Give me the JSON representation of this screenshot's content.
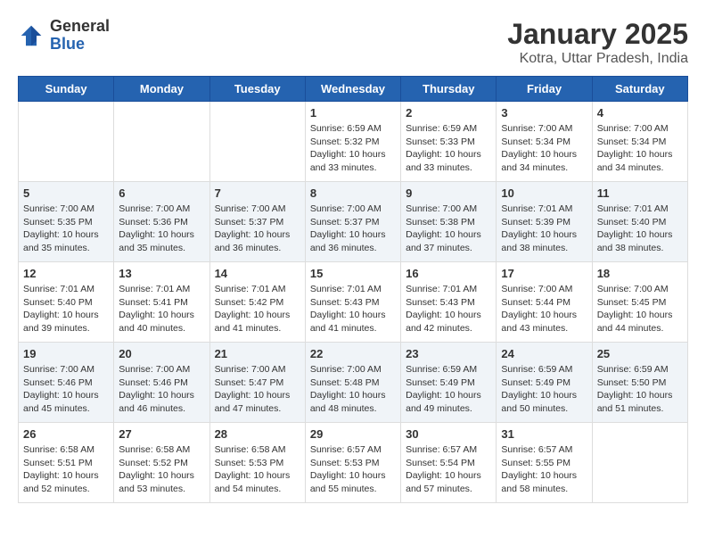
{
  "header": {
    "logo_general": "General",
    "logo_blue": "Blue",
    "title": "January 2025",
    "subtitle": "Kotra, Uttar Pradesh, India"
  },
  "days_of_week": [
    "Sunday",
    "Monday",
    "Tuesday",
    "Wednesday",
    "Thursday",
    "Friday",
    "Saturday"
  ],
  "weeks": [
    [
      {
        "day": "",
        "info": ""
      },
      {
        "day": "",
        "info": ""
      },
      {
        "day": "",
        "info": ""
      },
      {
        "day": "1",
        "info": "Sunrise: 6:59 AM\nSunset: 5:32 PM\nDaylight: 10 hours\nand 33 minutes."
      },
      {
        "day": "2",
        "info": "Sunrise: 6:59 AM\nSunset: 5:33 PM\nDaylight: 10 hours\nand 33 minutes."
      },
      {
        "day": "3",
        "info": "Sunrise: 7:00 AM\nSunset: 5:34 PM\nDaylight: 10 hours\nand 34 minutes."
      },
      {
        "day": "4",
        "info": "Sunrise: 7:00 AM\nSunset: 5:34 PM\nDaylight: 10 hours\nand 34 minutes."
      }
    ],
    [
      {
        "day": "5",
        "info": "Sunrise: 7:00 AM\nSunset: 5:35 PM\nDaylight: 10 hours\nand 35 minutes."
      },
      {
        "day": "6",
        "info": "Sunrise: 7:00 AM\nSunset: 5:36 PM\nDaylight: 10 hours\nand 35 minutes."
      },
      {
        "day": "7",
        "info": "Sunrise: 7:00 AM\nSunset: 5:37 PM\nDaylight: 10 hours\nand 36 minutes."
      },
      {
        "day": "8",
        "info": "Sunrise: 7:00 AM\nSunset: 5:37 PM\nDaylight: 10 hours\nand 36 minutes."
      },
      {
        "day": "9",
        "info": "Sunrise: 7:00 AM\nSunset: 5:38 PM\nDaylight: 10 hours\nand 37 minutes."
      },
      {
        "day": "10",
        "info": "Sunrise: 7:01 AM\nSunset: 5:39 PM\nDaylight: 10 hours\nand 38 minutes."
      },
      {
        "day": "11",
        "info": "Sunrise: 7:01 AM\nSunset: 5:40 PM\nDaylight: 10 hours\nand 38 minutes."
      }
    ],
    [
      {
        "day": "12",
        "info": "Sunrise: 7:01 AM\nSunset: 5:40 PM\nDaylight: 10 hours\nand 39 minutes."
      },
      {
        "day": "13",
        "info": "Sunrise: 7:01 AM\nSunset: 5:41 PM\nDaylight: 10 hours\nand 40 minutes."
      },
      {
        "day": "14",
        "info": "Sunrise: 7:01 AM\nSunset: 5:42 PM\nDaylight: 10 hours\nand 41 minutes."
      },
      {
        "day": "15",
        "info": "Sunrise: 7:01 AM\nSunset: 5:43 PM\nDaylight: 10 hours\nand 41 minutes."
      },
      {
        "day": "16",
        "info": "Sunrise: 7:01 AM\nSunset: 5:43 PM\nDaylight: 10 hours\nand 42 minutes."
      },
      {
        "day": "17",
        "info": "Sunrise: 7:00 AM\nSunset: 5:44 PM\nDaylight: 10 hours\nand 43 minutes."
      },
      {
        "day": "18",
        "info": "Sunrise: 7:00 AM\nSunset: 5:45 PM\nDaylight: 10 hours\nand 44 minutes."
      }
    ],
    [
      {
        "day": "19",
        "info": "Sunrise: 7:00 AM\nSunset: 5:46 PM\nDaylight: 10 hours\nand 45 minutes."
      },
      {
        "day": "20",
        "info": "Sunrise: 7:00 AM\nSunset: 5:46 PM\nDaylight: 10 hours\nand 46 minutes."
      },
      {
        "day": "21",
        "info": "Sunrise: 7:00 AM\nSunset: 5:47 PM\nDaylight: 10 hours\nand 47 minutes."
      },
      {
        "day": "22",
        "info": "Sunrise: 7:00 AM\nSunset: 5:48 PM\nDaylight: 10 hours\nand 48 minutes."
      },
      {
        "day": "23",
        "info": "Sunrise: 6:59 AM\nSunset: 5:49 PM\nDaylight: 10 hours\nand 49 minutes."
      },
      {
        "day": "24",
        "info": "Sunrise: 6:59 AM\nSunset: 5:49 PM\nDaylight: 10 hours\nand 50 minutes."
      },
      {
        "day": "25",
        "info": "Sunrise: 6:59 AM\nSunset: 5:50 PM\nDaylight: 10 hours\nand 51 minutes."
      }
    ],
    [
      {
        "day": "26",
        "info": "Sunrise: 6:58 AM\nSunset: 5:51 PM\nDaylight: 10 hours\nand 52 minutes."
      },
      {
        "day": "27",
        "info": "Sunrise: 6:58 AM\nSunset: 5:52 PM\nDaylight: 10 hours\nand 53 minutes."
      },
      {
        "day": "28",
        "info": "Sunrise: 6:58 AM\nSunset: 5:53 PM\nDaylight: 10 hours\nand 54 minutes."
      },
      {
        "day": "29",
        "info": "Sunrise: 6:57 AM\nSunset: 5:53 PM\nDaylight: 10 hours\nand 55 minutes."
      },
      {
        "day": "30",
        "info": "Sunrise: 6:57 AM\nSunset: 5:54 PM\nDaylight: 10 hours\nand 57 minutes."
      },
      {
        "day": "31",
        "info": "Sunrise: 6:57 AM\nSunset: 5:55 PM\nDaylight: 10 hours\nand 58 minutes."
      },
      {
        "day": "",
        "info": ""
      }
    ]
  ]
}
